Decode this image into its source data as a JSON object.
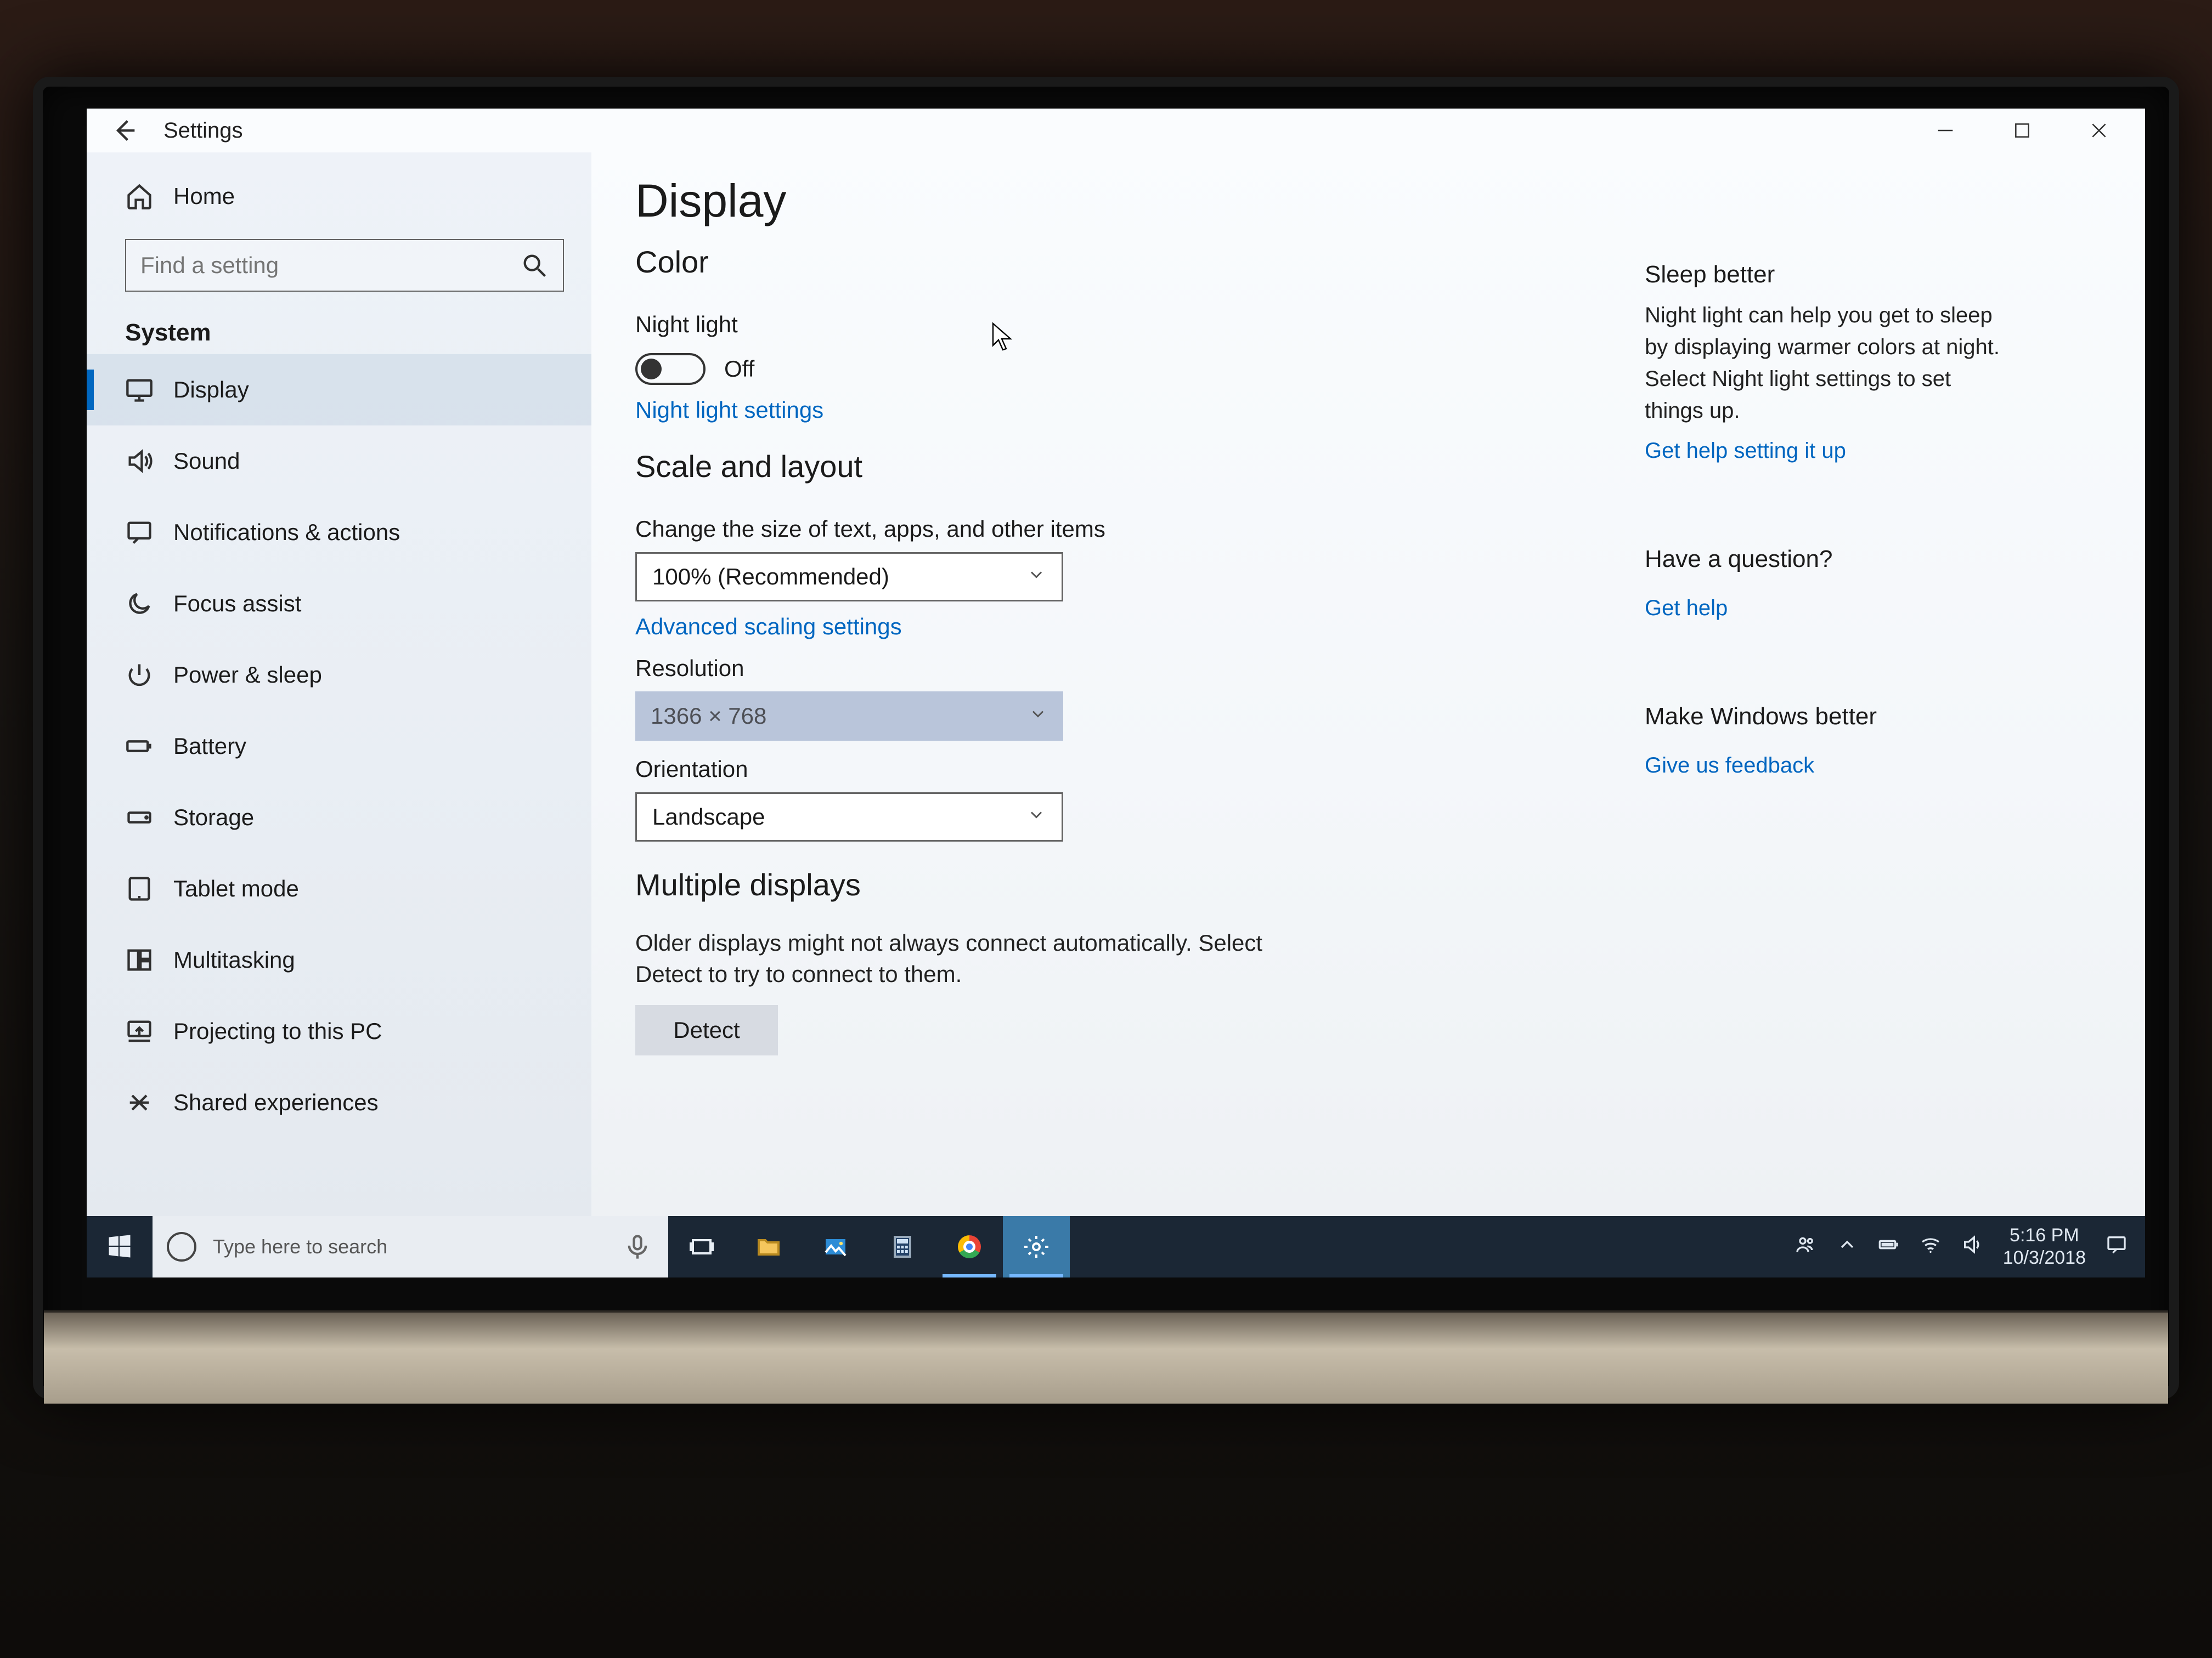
{
  "window": {
    "appTitle": "Settings",
    "pageTitle": "Display"
  },
  "sidebar": {
    "home": "Home",
    "searchPlaceholder": "Find a setting",
    "category": "System",
    "items": [
      {
        "label": "Display",
        "active": true
      },
      {
        "label": "Sound",
        "active": false
      },
      {
        "label": "Notifications & actions",
        "active": false
      },
      {
        "label": "Focus assist",
        "active": false
      },
      {
        "label": "Power & sleep",
        "active": false
      },
      {
        "label": "Battery",
        "active": false
      },
      {
        "label": "Storage",
        "active": false
      },
      {
        "label": "Tablet mode",
        "active": false
      },
      {
        "label": "Multitasking",
        "active": false
      },
      {
        "label": "Projecting to this PC",
        "active": false
      },
      {
        "label": "Shared experiences",
        "active": false
      }
    ]
  },
  "color": {
    "heading": "Color",
    "nightLightLabel": "Night light",
    "nightLightState": "Off",
    "nightLightSettingsLink": "Night light settings"
  },
  "scale": {
    "heading": "Scale and layout",
    "textSizeLabel": "Change the size of text, apps, and other items",
    "textSizeValue": "100% (Recommended)",
    "advancedLink": "Advanced scaling settings",
    "resolutionLabel": "Resolution",
    "resolutionValue": "1366 × 768",
    "orientationLabel": "Orientation",
    "orientationValue": "Landscape"
  },
  "multi": {
    "heading": "Multiple displays",
    "desc": "Older displays might not always connect automatically. Select Detect to try to connect to them.",
    "detect": "Detect"
  },
  "right": {
    "sleepTitle": "Sleep better",
    "sleepBody": "Night light can help you get to sleep by displaying warmer colors at night. Select Night light settings to set things up.",
    "sleepLink": "Get help setting it up",
    "questionTitle": "Have a question?",
    "questionLink": "Get help",
    "feedbackTitle": "Make Windows better",
    "feedbackLink": "Give us feedback"
  },
  "taskbar": {
    "searchPlaceholder": "Type here to search",
    "time": "5:16 PM",
    "date": "10/3/2018"
  }
}
